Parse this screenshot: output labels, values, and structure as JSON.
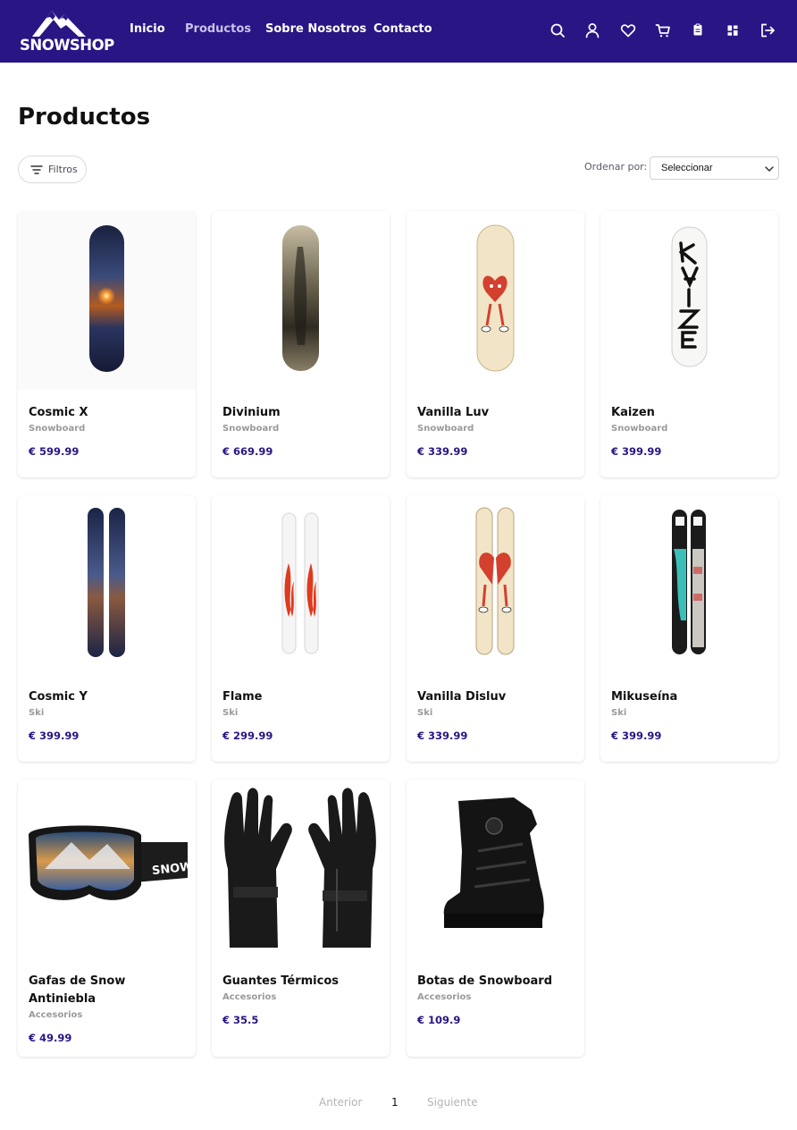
{
  "brand": {
    "name": "SNOWSHOP"
  },
  "nav": [
    {
      "label": "Inicio",
      "active": false
    },
    {
      "label": "Productos",
      "active": true
    },
    {
      "label": "Sobre Nosotros",
      "active": false
    },
    {
      "label": "Contacto",
      "active": false
    }
  ],
  "header_icons": [
    "search-icon",
    "user-icon",
    "heart-icon",
    "cart-icon",
    "clipboard-icon",
    "dashboard-icon",
    "logout-icon"
  ],
  "page": {
    "title": "Productos",
    "filter_label": "Filtros",
    "sort_label": "Ordenar por:",
    "sort_value": "Seleccionar"
  },
  "products": [
    {
      "name": "Cosmic X",
      "category": "Snowboard",
      "price": "€ 599.99",
      "image": "snowboard-cosmic"
    },
    {
      "name": "Divinium",
      "category": "Snowboard",
      "price": "€ 669.99",
      "image": "snowboard-divinium"
    },
    {
      "name": "Vanilla Luv",
      "category": "Snowboard",
      "price": "€ 339.99",
      "image": "snowboard-vanilla"
    },
    {
      "name": "Kaizen",
      "category": "Snowboard",
      "price": "€ 399.99",
      "image": "snowboard-kaizen"
    },
    {
      "name": "Cosmic Y",
      "category": "Ski",
      "price": "€ 399.99",
      "image": "ski-cosmic"
    },
    {
      "name": "Flame",
      "category": "Ski",
      "price": "€ 299.99",
      "image": "ski-flame"
    },
    {
      "name": "Vanilla Disluv",
      "category": "Ski",
      "price": "€ 339.99",
      "image": "ski-vanilla"
    },
    {
      "name": "Mikuseína",
      "category": "Ski",
      "price": "€ 399.99",
      "image": "ski-miku"
    },
    {
      "name": "Gafas de Snow Antiniebla",
      "category": "Accesorios",
      "price": "€ 49.99",
      "image": "goggles",
      "goggles_strap_text": "SNOWSHOP"
    },
    {
      "name": "Guantes Térmicos",
      "category": "Accesorios",
      "price": "€ 35.5",
      "image": "gloves"
    },
    {
      "name": "Botas de Snowboard",
      "category": "Accesorios",
      "price": "€ 109.9",
      "image": "boots"
    }
  ],
  "pagination": {
    "prev": "Anterior",
    "current": "1",
    "next": "Siguiente"
  },
  "colors": {
    "header_bg": "#2a1585",
    "price": "#2a1585",
    "nav_active": "#c9c2ea"
  }
}
